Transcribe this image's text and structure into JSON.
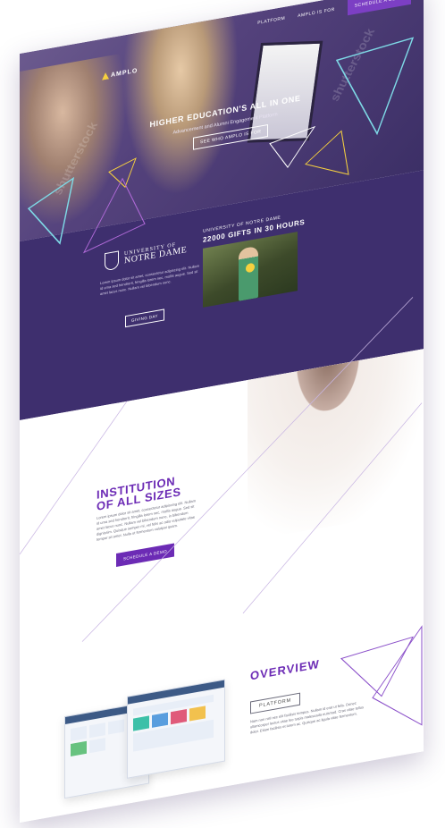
{
  "nav": {
    "logo": "AMPLO",
    "links": [
      "PLATFORM",
      "AMPLO IS FOR"
    ],
    "cta": "SCHEDULE A DEMO"
  },
  "hero": {
    "title": "HIGHER EDUCATION'S ALL IN ONE",
    "subtitle": "Advancement and Alumni Engagement Platform",
    "cta": "SEE WHO AMPLO IS FOR",
    "watermark": "shutterstock"
  },
  "case_study": {
    "logo_line1": "UNIVERSITY OF",
    "logo_line2": "NOTRE DAME",
    "body": "Lorem ipsum dolor sit amet, consectetur adipiscing elit. Nullam id urna sed hendrerit, fringilla lorem nec, mollis augue. Sed sit amet lacus nunc. Nullam vel bibendum nunc.",
    "button": "GIVING DAY",
    "video_kicker": "UNIVERSITY OF NOTRE DAME",
    "video_title": "22000 GIFTS IN 30 HOURS"
  },
  "institution": {
    "title_line1": "INSTITUTION",
    "title_line2": "OF ALL SIZES",
    "body": "Lorem ipsum dolor sit amet, consectetur adipiscing elit. Nullam id urna sed hendrerit, fringilla lorem nec, mollis augue. Sed sit amet lacus nunc. Nullam vel bibendum nunc, in bibendum dignissim. Quisque semper mi, vel felis ac odio vulputate vitae tempor sit amet. Nulla ut fermentum volutpat quam.",
    "cta": "SCHEDULE A DEMO"
  },
  "overview": {
    "title": "OVERVIEW",
    "tab": "PLATFORM",
    "body": "Nam non nisl nec elit facilisis tempus. Nullam id erat ut felis. Donec ullamcorper lectus vitae leo turpis malesuada euismod. Cras vitae tellus dolor. Etiam facilisis et lorem ac. Quisque ac ligula vitae fermentum."
  },
  "colors": {
    "brand_purple": "#6c2bb5",
    "band_purple": "#3e2f6e",
    "accent_yellow": "#f6d03f"
  }
}
